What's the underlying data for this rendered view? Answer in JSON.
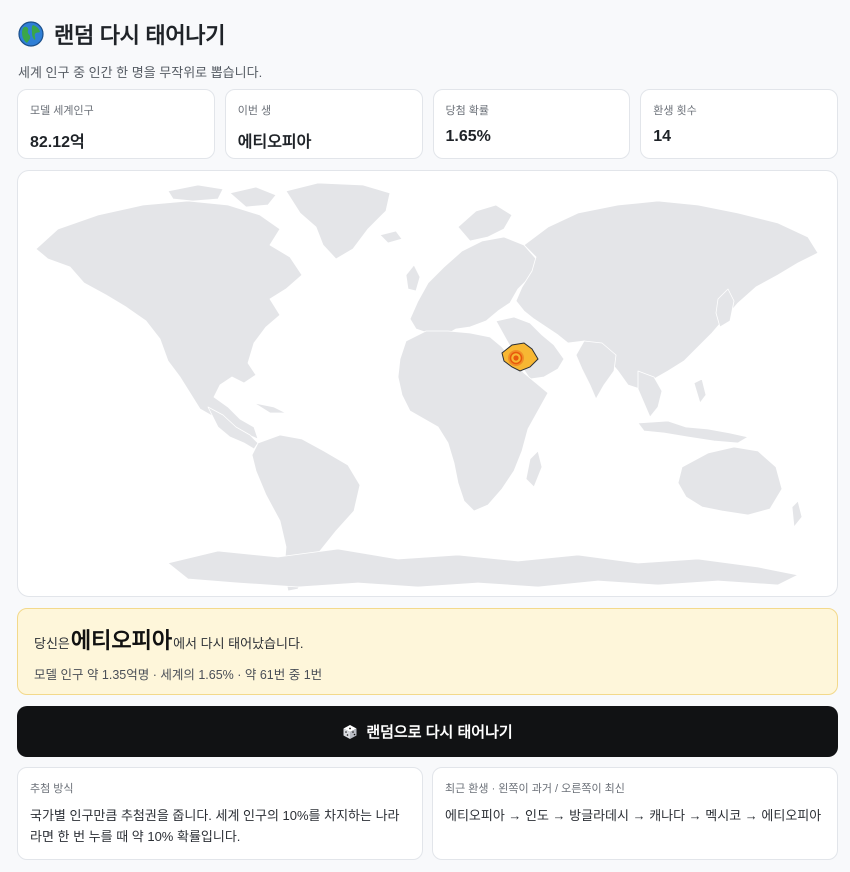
{
  "header": {
    "title": "랜덤 다시 태어나기",
    "subtitle": "세계 인구 중 인간 한 명을 무작위로 뽑습니다."
  },
  "stats": [
    {
      "label": "모델 세계인구",
      "value": "82.12억"
    },
    {
      "label": "이번 생",
      "value": "에티오피아"
    },
    {
      "label": "당첨 확률",
      "value": "1.65%"
    },
    {
      "label": "환생 횟수",
      "value": "14"
    }
  ],
  "map": {
    "highlight_country": "에티오피아",
    "land_color": "#e4e5e8",
    "border_color": "#ffffff",
    "highlight_color": "#f7b733",
    "marker_color": "#e8590c"
  },
  "result": {
    "prefix": "당신은 ",
    "country": "에티오피아",
    "suffix": "에서 다시 태어났습니다.",
    "detail": "모델 인구 약 1.35억명 · 세계의 1.65% · 약 61번 중 1번"
  },
  "action": {
    "button_label": "랜덤으로 다시 태어나기"
  },
  "method": {
    "label": "추첨 방식",
    "text": "국가별 인구만큼 추첨권을 줍니다. 세계 인구의 10%를 차지하는 나라라면 한 번 누를 때 약 10% 확률입니다."
  },
  "history": {
    "label": "최근 환생 · 왼쪽이 과거 / 오른쪽이 최신",
    "text": "에티오피아 → 인도 → 방글라데시 → 캐나다 → 멕시코 → 에티오피아"
  }
}
